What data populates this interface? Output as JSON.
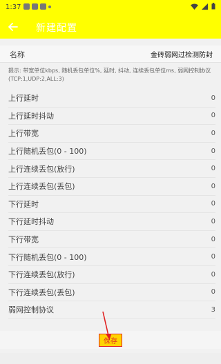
{
  "status": {
    "time": "1:37"
  },
  "appbar": {
    "title": "新建配置",
    "back_icon": "arrow-left-icon"
  },
  "name_field": {
    "label": "名称",
    "value": "金砖弱网过检测防封"
  },
  "hint": "提示: 带宽单位kbps, 随机丢包单位%, 延时, 抖动, 连续丢包单位ms, 弱网控制协议(TCP:1,UDP:2,ALL:3)",
  "rows": [
    {
      "label": "上行延时",
      "value": "0"
    },
    {
      "label": "上行延时抖动",
      "value": "0"
    },
    {
      "label": "上行带宽",
      "value": "0"
    },
    {
      "label": "上行随机丢包(0 - 100)",
      "value": "0"
    },
    {
      "label": "上行连续丢包(放行)",
      "value": "0"
    },
    {
      "label": "上行连续丢包(丢包)",
      "value": "0"
    },
    {
      "label": "下行延时",
      "value": "0"
    },
    {
      "label": "下行延时抖动",
      "value": "0"
    },
    {
      "label": "下行带宽",
      "value": "0"
    },
    {
      "label": "下行随机丢包(0 - 100)",
      "value": "0"
    },
    {
      "label": "下行连续丢包(放行)",
      "value": "0"
    },
    {
      "label": "下行连续丢包(丢包)",
      "value": "0"
    },
    {
      "label": "弱网控制协议",
      "value": "3"
    }
  ],
  "save_label": "保存",
  "colors": {
    "appbar": "#ffff00",
    "highlight_border": "#e02020",
    "save_button": "#ffd400"
  }
}
